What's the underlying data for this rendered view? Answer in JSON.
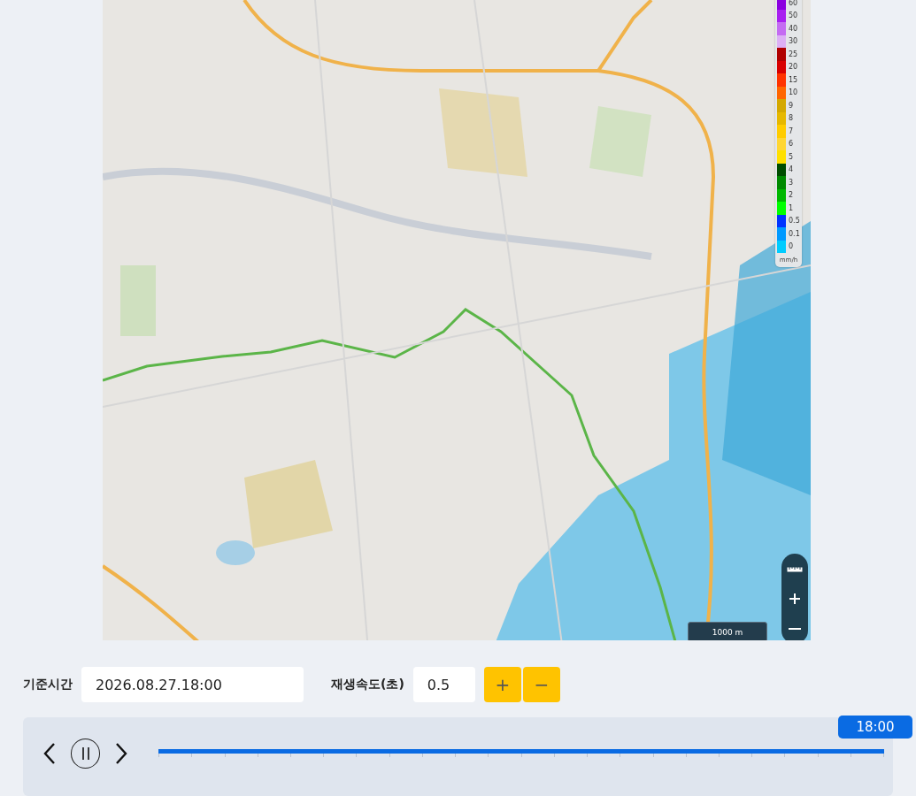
{
  "map": {
    "legend": {
      "unit": "mm/h",
      "items": [
        {
          "label": "60",
          "color": "#8b00e0"
        },
        {
          "label": "50",
          "color": "#a81ff0"
        },
        {
          "label": "40",
          "color": "#c46cf2"
        },
        {
          "label": "30",
          "color": "#ddb0f5"
        },
        {
          "label": "25",
          "color": "#b00000"
        },
        {
          "label": "20",
          "color": "#d80000"
        },
        {
          "label": "15",
          "color": "#ff3300"
        },
        {
          "label": "10",
          "color": "#ff6600"
        },
        {
          "label": "9",
          "color": "#d4a800"
        },
        {
          "label": "8",
          "color": "#e6b800"
        },
        {
          "label": "7",
          "color": "#ffcc00"
        },
        {
          "label": "6",
          "color": "#ffd633"
        },
        {
          "label": "5",
          "color": "#ffe000"
        },
        {
          "label": "4",
          "color": "#004d00"
        },
        {
          "label": "3",
          "color": "#008a00"
        },
        {
          "label": "2",
          "color": "#00b800"
        },
        {
          "label": "1",
          "color": "#00ff00"
        },
        {
          "label": "0.5",
          "color": "#0033ff"
        },
        {
          "label": "0.1",
          "color": "#0099ff"
        },
        {
          "label": "0",
          "color": "#00ccff"
        }
      ]
    },
    "scale": "1000 m"
  },
  "controls": {
    "base_time": {
      "label": "기준시간",
      "value": "2026.08.27.18:00"
    },
    "speed": {
      "label": "재생속도(초)",
      "value": "0.5"
    },
    "speed_buttons": [
      "+",
      "−"
    ]
  },
  "timeline": {
    "playing": true,
    "level": 1,
    "tooltip": "18:00"
  }
}
